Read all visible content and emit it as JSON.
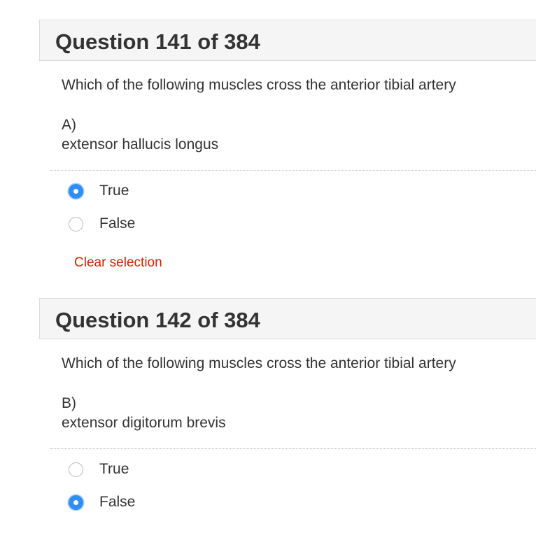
{
  "questions": [
    {
      "title": "Question 141 of 384",
      "prompt": "Which of the following muscles cross the anterior tibial artery",
      "option_letter": "A)",
      "option_text": "extensor hallucis longus",
      "choices": [
        {
          "label": "True",
          "selected": true
        },
        {
          "label": "False",
          "selected": false
        }
      ],
      "clear_label": "Clear selection"
    },
    {
      "title": "Question 142 of 384",
      "prompt": "Which of the following muscles cross the anterior tibial artery",
      "option_letter": "B)",
      "option_text": "extensor digitorum brevis",
      "choices": [
        {
          "label": "True",
          "selected": false
        },
        {
          "label": "False",
          "selected": true
        }
      ]
    }
  ],
  "colors": {
    "accent": "#2f8ef4",
    "link_red": "#cc2200",
    "header_bg": "#f5f5f5",
    "text": "#333333"
  }
}
